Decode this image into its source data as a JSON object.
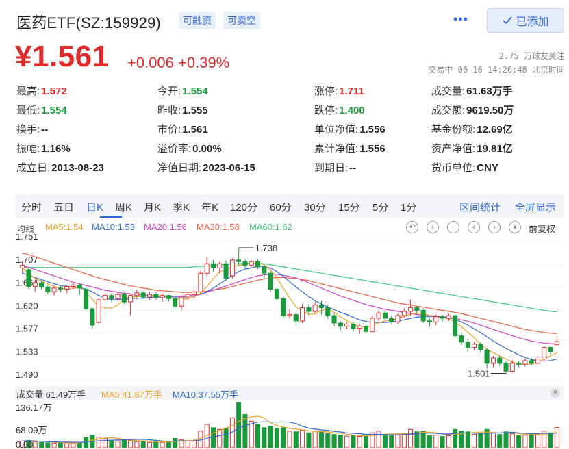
{
  "header": {
    "title": "医药ETF(SZ:159929)",
    "tags": [
      "可融资",
      "可卖空"
    ],
    "more": "•••",
    "added_label": "已添加",
    "price": "¥1.561",
    "change": "+0.006 +0.39%",
    "followers": "2.75 万球友关注",
    "trade_info": "交易中 06-16 14:20:48 北京时间"
  },
  "stats": {
    "high_label": "最高:",
    "high": "1.572",
    "low_label": "最低:",
    "low": "1.554",
    "turnover_label": "换手:",
    "turnover": "--",
    "amplitude_label": "振幅:",
    "amplitude": "1.16%",
    "listed_label": "成立日:",
    "listed": "2013-08-23",
    "open_label": "今开:",
    "open": "1.554",
    "prev_label": "昨收:",
    "prev": "1.555",
    "mprice_label": "市价:",
    "mprice": "1.561",
    "premium_label": "溢价率:",
    "premium": "0.00%",
    "navdate_label": "净值日期:",
    "navdate": "2023-06-15",
    "limitup_label": "涨停:",
    "limitup": "1.711",
    "limitdown_label": "跌停:",
    "limitdown": "1.400",
    "unitnav_label": "单位净值:",
    "unitnav": "1.556",
    "cumnav_label": "累计净值:",
    "cumnav": "1.556",
    "expiry_label": "到期日:",
    "expiry": "--",
    "volume_label": "成交量:",
    "volume": "61.63万手",
    "amount_label": "成交额:",
    "amount": "9619.50万",
    "shares_label": "基金份额:",
    "shares": "12.69亿",
    "assets_label": "资产净值:",
    "assets": "19.81亿",
    "currency_label": "货币单位:",
    "currency": "CNY"
  },
  "tabs": [
    "分时",
    "五日",
    "日K",
    "周K",
    "月K",
    "季K",
    "年K",
    "120分",
    "60分",
    "30分",
    "15分",
    "5分",
    "1分"
  ],
  "tab_links": [
    "区间统计",
    "全屏显示"
  ],
  "legend": {
    "mean": "均线",
    "ma5": "MA5:1.54",
    "ma10": "MA10:1.53",
    "ma20": "MA20:1.56",
    "ma30": "MA30:1.58",
    "ma60": "MA60:1.62",
    "adjust": "前复权"
  },
  "colors": {
    "up": "#e02a2a",
    "down": "#1a9a3a",
    "ma5": "#f0a020",
    "ma10": "#2f6ad8",
    "ma20": "#d040c8",
    "ma30": "#f06040",
    "ma60": "#40c880"
  },
  "chart_data": {
    "type": "candlestick",
    "y_ticks": [
      "1.751",
      "1.707",
      "1.664",
      "1.620",
      "1.577",
      "1.533",
      "1.490"
    ],
    "ylim": [
      1.49,
      1.751
    ],
    "max_label": "1.738",
    "min_label": "1.501",
    "candles": [
      [
        1.7,
        1.705,
        1.69,
        1.712
      ],
      [
        1.697,
        1.665,
        1.66,
        1.7
      ],
      [
        1.665,
        1.672,
        1.655,
        1.678
      ],
      [
        1.672,
        1.664,
        1.66,
        1.675
      ],
      [
        1.664,
        1.655,
        1.65,
        1.668
      ],
      [
        1.655,
        1.662,
        1.648,
        1.666
      ],
      [
        1.662,
        1.66,
        1.654,
        1.666
      ],
      [
        1.66,
        1.665,
        1.652,
        1.668
      ],
      [
        1.665,
        1.668,
        1.66,
        1.672
      ],
      [
        1.668,
        1.662,
        1.65,
        1.672
      ],
      [
        1.66,
        1.623,
        1.618,
        1.664
      ],
      [
        1.623,
        1.592,
        1.585,
        1.626
      ],
      [
        1.597,
        1.64,
        1.595,
        1.642
      ],
      [
        1.64,
        1.648,
        1.638,
        1.652
      ],
      [
        1.648,
        1.642,
        1.636,
        1.652
      ],
      [
        1.642,
        1.65,
        1.638,
        1.654
      ],
      [
        1.65,
        1.636,
        1.632,
        1.654
      ],
      [
        1.636,
        1.648,
        1.61,
        1.652
      ],
      [
        1.648,
        1.653,
        1.64,
        1.658
      ],
      [
        1.653,
        1.645,
        1.642,
        1.656
      ],
      [
        1.645,
        1.65,
        1.64,
        1.655
      ],
      [
        1.65,
        1.644,
        1.64,
        1.654
      ],
      [
        1.644,
        1.648,
        1.636,
        1.652
      ],
      [
        1.648,
        1.642,
        1.636,
        1.65
      ],
      [
        1.642,
        1.628,
        1.622,
        1.646
      ],
      [
        1.628,
        1.645,
        1.62,
        1.648
      ],
      [
        1.645,
        1.65,
        1.638,
        1.652
      ],
      [
        1.65,
        1.655,
        1.642,
        1.66
      ],
      [
        1.655,
        1.69,
        1.65,
        1.694
      ],
      [
        1.69,
        1.708,
        1.685,
        1.72
      ],
      [
        1.708,
        1.7,
        1.693,
        1.715
      ],
      [
        1.7,
        1.708,
        1.69,
        1.712
      ],
      [
        1.708,
        1.68,
        1.675,
        1.714
      ],
      [
        1.685,
        1.715,
        1.68,
        1.718
      ],
      [
        1.715,
        1.712,
        1.705,
        1.738
      ],
      [
        1.712,
        1.705,
        1.7,
        1.716
      ],
      [
        1.705,
        1.712,
        1.702,
        1.714
      ],
      [
        1.712,
        1.702,
        1.698,
        1.716
      ],
      [
        1.702,
        1.69,
        1.68,
        1.706
      ],
      [
        1.69,
        1.66,
        1.655,
        1.694
      ],
      [
        1.66,
        1.642,
        1.638,
        1.664
      ],
      [
        1.642,
        1.61,
        1.605,
        1.646
      ],
      [
        1.61,
        1.612,
        1.604,
        1.622
      ],
      [
        1.612,
        1.6,
        1.59,
        1.616
      ],
      [
        1.6,
        1.625,
        1.596,
        1.632
      ],
      [
        1.625,
        1.618,
        1.61,
        1.632
      ],
      [
        1.618,
        1.63,
        1.614,
        1.636
      ],
      [
        1.63,
        1.625,
        1.612,
        1.638
      ],
      [
        1.625,
        1.61,
        1.604,
        1.63
      ],
      [
        1.61,
        1.596,
        1.59,
        1.614
      ],
      [
        1.596,
        1.59,
        1.582,
        1.6
      ],
      [
        1.59,
        1.594,
        1.585,
        1.598
      ],
      [
        1.594,
        1.586,
        1.58,
        1.598
      ],
      [
        1.586,
        1.59,
        1.576,
        1.594
      ],
      [
        1.59,
        1.58,
        1.576,
        1.594
      ],
      [
        1.58,
        1.605,
        1.578,
        1.61
      ],
      [
        1.605,
        1.615,
        1.6,
        1.62
      ],
      [
        1.615,
        1.605,
        1.6,
        1.618
      ],
      [
        1.605,
        1.598,
        1.594,
        1.61
      ],
      [
        1.598,
        1.61,
        1.594,
        1.614
      ],
      [
        1.61,
        1.618,
        1.605,
        1.624
      ],
      [
        1.618,
        1.625,
        1.61,
        1.64
      ],
      [
        1.625,
        1.62,
        1.612,
        1.628
      ],
      [
        1.62,
        1.6,
        1.596,
        1.624
      ],
      [
        1.6,
        1.598,
        1.59,
        1.604
      ],
      [
        1.598,
        1.608,
        1.592,
        1.612
      ],
      [
        1.608,
        1.605,
        1.598,
        1.612
      ],
      [
        1.605,
        1.61,
        1.6,
        1.614
      ],
      [
        1.61,
        1.572,
        1.568,
        1.612
      ],
      [
        1.572,
        1.56,
        1.554,
        1.578
      ],
      [
        1.56,
        1.55,
        1.54,
        1.566
      ],
      [
        1.55,
        1.556,
        1.544,
        1.56
      ],
      [
        1.556,
        1.545,
        1.54,
        1.56
      ],
      [
        1.545,
        1.52,
        1.51,
        1.548
      ],
      [
        1.52,
        1.53,
        1.512,
        1.534
      ],
      [
        1.53,
        1.52,
        1.515,
        1.535
      ],
      [
        1.52,
        1.505,
        1.501,
        1.524
      ],
      [
        1.505,
        1.52,
        1.502,
        1.526
      ],
      [
        1.52,
        1.518,
        1.512,
        1.524
      ],
      [
        1.518,
        1.525,
        1.514,
        1.528
      ],
      [
        1.525,
        1.52,
        1.516,
        1.53
      ],
      [
        1.52,
        1.528,
        1.516,
        1.534
      ],
      [
        1.528,
        1.55,
        1.524,
        1.552
      ],
      [
        1.55,
        1.542,
        1.536,
        1.552
      ],
      [
        1.555,
        1.561,
        1.554,
        1.572
      ]
    ],
    "ma5": [
      1.7,
      1.69,
      1.68,
      1.675,
      1.67,
      1.665,
      1.662,
      1.66,
      1.662,
      1.663,
      1.655,
      1.64,
      1.628,
      1.625,
      1.624,
      1.63,
      1.643,
      1.645,
      1.646,
      1.646,
      1.648,
      1.648,
      1.647,
      1.646,
      1.642,
      1.641,
      1.642,
      1.645,
      1.652,
      1.665,
      1.68,
      1.692,
      1.697,
      1.702,
      1.705,
      1.707,
      1.708,
      1.71,
      1.706,
      1.696,
      1.682,
      1.662,
      1.643,
      1.627,
      1.618,
      1.613,
      1.613,
      1.62,
      1.622,
      1.616,
      1.608,
      1.601,
      1.593,
      1.59,
      1.588,
      1.591,
      1.596,
      1.6,
      1.601,
      1.605,
      1.609,
      1.613,
      1.615,
      1.614,
      1.61,
      1.607,
      1.606,
      1.604,
      1.598,
      1.589,
      1.579,
      1.568,
      1.556,
      1.546,
      1.54,
      1.534,
      1.528,
      1.522,
      1.519,
      1.518,
      1.518,
      1.522,
      1.528,
      1.534,
      1.54
    ],
    "ma10": [
      1.69,
      1.686,
      1.682,
      1.678,
      1.674,
      1.67,
      1.667,
      1.665,
      1.664,
      1.663,
      1.66,
      1.655,
      1.648,
      1.643,
      1.64,
      1.64,
      1.641,
      1.642,
      1.643,
      1.643,
      1.644,
      1.645,
      1.645,
      1.646,
      1.645,
      1.645,
      1.646,
      1.647,
      1.65,
      1.655,
      1.662,
      1.67,
      1.678,
      1.686,
      1.693,
      1.698,
      1.7,
      1.703,
      1.703,
      1.7,
      1.693,
      1.684,
      1.674,
      1.664,
      1.655,
      1.646,
      1.638,
      1.632,
      1.626,
      1.621,
      1.616,
      1.612,
      1.607,
      1.602,
      1.599,
      1.597,
      1.597,
      1.597,
      1.598,
      1.6,
      1.602,
      1.605,
      1.607,
      1.608,
      1.608,
      1.608,
      1.607,
      1.606,
      1.603,
      1.598,
      1.592,
      1.585,
      1.578,
      1.57,
      1.562,
      1.555,
      1.548,
      1.542,
      1.536,
      1.531,
      1.527,
      1.525,
      1.524,
      1.525,
      1.528
    ],
    "ma20": [
      1.705,
      1.701,
      1.697,
      1.693,
      1.689,
      1.685,
      1.681,
      1.677,
      1.673,
      1.67,
      1.667,
      1.664,
      1.661,
      1.658,
      1.656,
      1.654,
      1.652,
      1.651,
      1.65,
      1.649,
      1.648,
      1.647,
      1.647,
      1.647,
      1.647,
      1.647,
      1.648,
      1.649,
      1.651,
      1.654,
      1.658,
      1.662,
      1.666,
      1.67,
      1.674,
      1.678,
      1.682,
      1.685,
      1.687,
      1.688,
      1.688,
      1.686,
      1.684,
      1.681,
      1.677,
      1.672,
      1.667,
      1.662,
      1.657,
      1.652,
      1.647,
      1.643,
      1.639,
      1.635,
      1.631,
      1.628,
      1.625,
      1.622,
      1.62,
      1.618,
      1.616,
      1.614,
      1.612,
      1.611,
      1.61,
      1.609,
      1.608,
      1.607,
      1.605,
      1.602,
      1.599,
      1.596,
      1.592,
      1.588,
      1.584,
      1.58,
      1.576,
      1.572,
      1.568,
      1.565,
      1.562,
      1.56,
      1.558,
      1.557,
      1.556
    ],
    "ma30": [
      1.728,
      1.725,
      1.721,
      1.717,
      1.713,
      1.709,
      1.705,
      1.701,
      1.697,
      1.693,
      1.689,
      1.685,
      1.681,
      1.678,
      1.675,
      1.672,
      1.669,
      1.666,
      1.664,
      1.662,
      1.66,
      1.658,
      1.657,
      1.656,
      1.655,
      1.654,
      1.654,
      1.654,
      1.655,
      1.656,
      1.658,
      1.66,
      1.662,
      1.665,
      1.668,
      1.671,
      1.674,
      1.677,
      1.679,
      1.681,
      1.682,
      1.682,
      1.681,
      1.68,
      1.678,
      1.676,
      1.673,
      1.67,
      1.667,
      1.664,
      1.661,
      1.658,
      1.655,
      1.652,
      1.649,
      1.646,
      1.643,
      1.64,
      1.637,
      1.634,
      1.632,
      1.63,
      1.628,
      1.626,
      1.624,
      1.622,
      1.62,
      1.618,
      1.616,
      1.614,
      1.611,
      1.608,
      1.605,
      1.602,
      1.599,
      1.596,
      1.593,
      1.59,
      1.587,
      1.584,
      1.582,
      1.58,
      1.578,
      1.577,
      1.576
    ],
    "ma60": [
      1.701,
      1.701,
      1.701,
      1.701,
      1.701,
      1.701,
      1.701,
      1.701,
      1.701,
      1.701,
      1.701,
      1.701,
      1.701,
      1.701,
      1.701,
      1.701,
      1.701,
      1.701,
      1.701,
      1.701,
      1.701,
      1.701,
      1.701,
      1.701,
      1.701,
      1.701,
      1.701,
      1.702,
      1.703,
      1.704,
      1.705,
      1.706,
      1.707,
      1.708,
      1.708,
      1.709,
      1.709,
      1.709,
      1.708,
      1.706,
      1.704,
      1.702,
      1.7,
      1.698,
      1.696,
      1.694,
      1.692,
      1.69,
      1.688,
      1.686,
      1.684,
      1.682,
      1.68,
      1.678,
      1.676,
      1.674,
      1.672,
      1.67,
      1.668,
      1.666,
      1.664,
      1.662,
      1.66,
      1.658,
      1.656,
      1.654,
      1.652,
      1.65,
      1.648,
      1.646,
      1.644,
      1.642,
      1.64,
      1.638,
      1.636,
      1.634,
      1.632,
      1.63,
      1.628,
      1.626,
      1.624,
      1.622,
      1.62,
      1.618,
      1.617
    ]
  },
  "volume": {
    "label": "成交量 61.49万手",
    "ma5": "MA5:41.87万手",
    "ma10": "MA10:37.55万手",
    "y_ticks": [
      "136.17万",
      "68.09万",
      "0.00"
    ],
    "max": 136.17,
    "values": [
      20,
      22,
      18,
      16,
      15,
      14,
      14,
      15,
      14,
      16,
      30,
      38,
      32,
      28,
      22,
      20,
      24,
      22,
      18,
      18,
      16,
      18,
      16,
      18,
      28,
      24,
      20,
      22,
      50,
      70,
      60,
      55,
      58,
      90,
      136,
      100,
      80,
      70,
      60,
      65,
      58,
      60,
      50,
      48,
      52,
      45,
      50,
      48,
      42,
      40,
      38,
      35,
      36,
      34,
      35,
      45,
      50,
      40,
      36,
      38,
      42,
      55,
      48,
      50,
      36,
      38,
      34,
      36,
      55,
      50,
      48,
      40,
      42,
      55,
      45,
      40,
      48,
      42,
      36,
      38,
      40,
      42,
      50,
      45,
      61
    ]
  }
}
